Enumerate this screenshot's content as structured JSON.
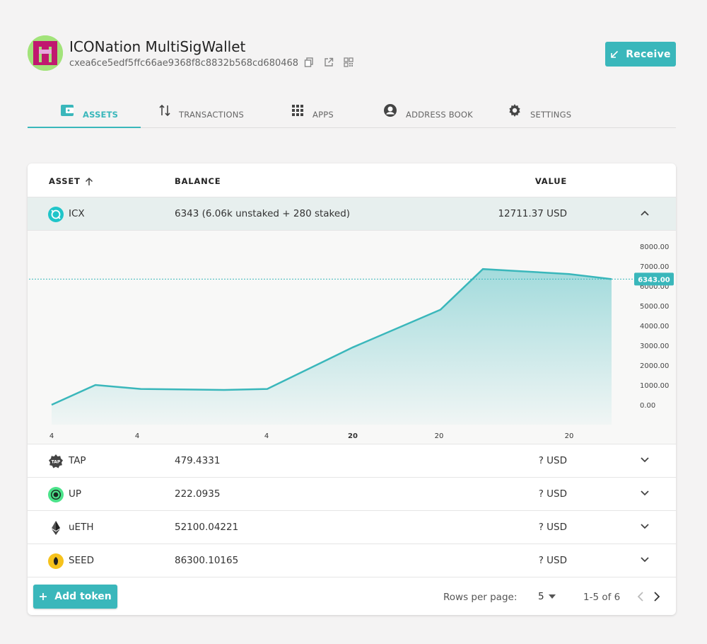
{
  "header": {
    "wallet_name": "ICONation MultiSigWallet",
    "wallet_address": "cxea6ce5edf5ffc66ae9368f8c8832b568cd680468",
    "receive_label": "Receive"
  },
  "tabs": [
    {
      "label": "ASSETS",
      "icon": "wallet-icon",
      "active": true
    },
    {
      "label": "TRANSACTIONS",
      "icon": "swap-vertical-icon",
      "active": false
    },
    {
      "label": "APPS",
      "icon": "grid-icon",
      "active": false
    },
    {
      "label": "ADDRESS BOOK",
      "icon": "account-circle-icon",
      "active": false
    },
    {
      "label": "SETTINGS",
      "icon": "gear-icon",
      "active": false
    }
  ],
  "table": {
    "columns": {
      "asset": "ASSET",
      "balance": "BALANCE",
      "value": "VALUE"
    },
    "rows": [
      {
        "symbol": "ICX",
        "balance": "6343 (6.06k unstaked + 280 staked)",
        "value": "12711.37 USD",
        "icon": "icx-icon",
        "expanded": true
      },
      {
        "symbol": "TAP",
        "balance": "479.4331",
        "value": "? USD",
        "icon": "tap-icon",
        "expanded": false
      },
      {
        "symbol": "UP",
        "balance": "222.0935",
        "value": "? USD",
        "icon": "up-icon",
        "expanded": false
      },
      {
        "symbol": "uETH",
        "balance": "52100.04221",
        "value": "? USD",
        "icon": "ethereum-icon",
        "expanded": false
      },
      {
        "symbol": "SEED",
        "balance": "86300.10165",
        "value": "? USD",
        "icon": "seed-icon",
        "expanded": false
      }
    ]
  },
  "chart_data": {
    "type": "area",
    "x_ticks": [
      "4",
      "4",
      "4",
      "20",
      "20",
      "20"
    ],
    "y_ticks": [
      "8000.00",
      "7000.00",
      "6000.00",
      "5000.00",
      "4000.00",
      "3000.00",
      "2000.00",
      "1000.00",
      "0.00"
    ],
    "ylim": [
      0,
      8000
    ],
    "current_value_label": "6343.00",
    "current_value": 6343,
    "values": [
      0,
      1000,
      800,
      750,
      800,
      2900,
      4800,
      6850,
      6600,
      6343
    ],
    "color": "#3ab7bb"
  },
  "footer": {
    "add_token_label": "Add token",
    "rows_per_page_label": "Rows per page:",
    "rows_per_page_value": "5",
    "range_text": "1-5 of 6"
  },
  "colors": {
    "accent": "#3ab7bb",
    "background": "#f4f3f3"
  }
}
